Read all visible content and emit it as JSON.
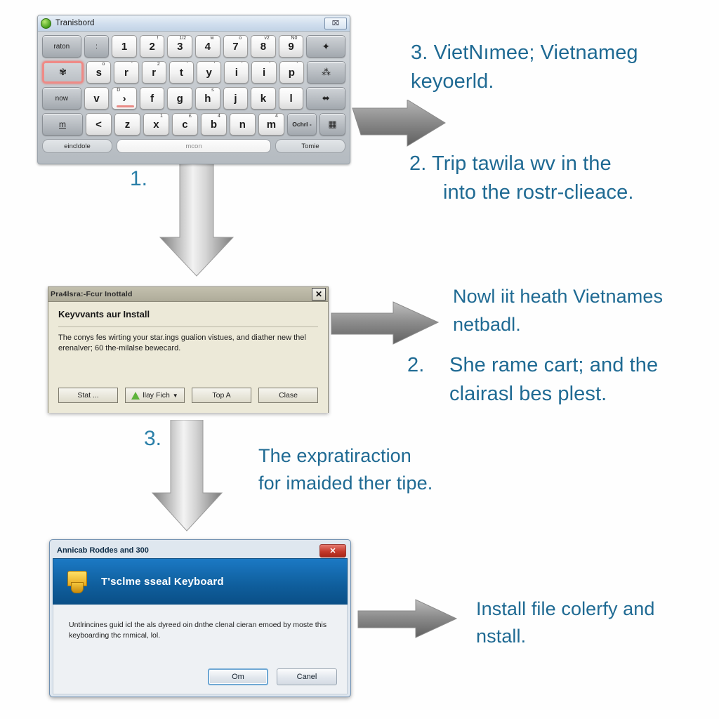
{
  "meta": {
    "accent_text_color": "#1f6a93",
    "arrow_color": "#9a9a9a",
    "canvas_bg": "#ffffff"
  },
  "osk": {
    "window_title": "Tranisbord",
    "minimize_label": "⌧",
    "rows": [
      {
        "id": "row-1",
        "keys": [
          {
            "label": "raton",
            "sup": "",
            "type": "dark",
            "width": "wide15"
          },
          {
            "label": ":",
            "sup": "",
            "type": "dark",
            "width": ""
          },
          {
            "label": "1",
            "sup": "",
            "type": "light",
            "width": ""
          },
          {
            "label": "2",
            "sup": "!",
            "type": "light",
            "width": ""
          },
          {
            "label": "3",
            "sup": "1/2",
            "type": "light",
            "width": ""
          },
          {
            "label": "4",
            "sup": "w",
            "type": "light",
            "width": ""
          },
          {
            "label": "7",
            "sup": "o",
            "type": "light",
            "width": ""
          },
          {
            "label": "8",
            "sup": "v2",
            "type": "light",
            "width": ""
          },
          {
            "label": "9",
            "sup": "N0",
            "type": "light",
            "width": ""
          },
          {
            "label": "✦",
            "sup": "",
            "type": "dark",
            "width": "wide15"
          }
        ]
      },
      {
        "id": "row-2",
        "keys": [
          {
            "label": "✾",
            "sup": "",
            "type": "dark selected",
            "width": "wide15"
          },
          {
            "label": "s",
            "sup": "o",
            "type": "light",
            "width": ""
          },
          {
            "label": "r",
            "sup": "'",
            "type": "light",
            "width": ""
          },
          {
            "label": "r",
            "sup": "2",
            "type": "light",
            "width": ""
          },
          {
            "label": "t",
            "sup": "'",
            "type": "light",
            "width": ""
          },
          {
            "label": "y",
            "sup": "'",
            "type": "light",
            "width": ""
          },
          {
            "label": "i",
            "sup": "'",
            "type": "light",
            "width": ""
          },
          {
            "label": "i",
            "sup": "'",
            "type": "light",
            "width": ""
          },
          {
            "label": "p",
            "sup": "'",
            "type": "light",
            "width": ""
          },
          {
            "label": "⁂",
            "sup": "",
            "type": "dark",
            "width": "wide15"
          }
        ]
      },
      {
        "id": "row-3",
        "keys": [
          {
            "label": "now",
            "sup": "",
            "type": "dark",
            "width": "wide15"
          },
          {
            "label": "v",
            "sup": "",
            "type": "light",
            "width": ""
          },
          {
            "label": "›",
            "sup": "D",
            "type": "light redmark",
            "width": ""
          },
          {
            "label": "f",
            "sup": "",
            "type": "light",
            "width": ""
          },
          {
            "label": "g",
            "sup": "",
            "type": "light",
            "width": ""
          },
          {
            "label": "h",
            "sup": "s",
            "type": "light",
            "width": ""
          },
          {
            "label": "j",
            "sup": "",
            "type": "light",
            "width": ""
          },
          {
            "label": "k",
            "sup": "",
            "type": "light",
            "width": ""
          },
          {
            "label": "l",
            "sup": "",
            "type": "light",
            "width": ""
          },
          {
            "label": "⬌",
            "sup": "",
            "type": "dark",
            "width": "wide15"
          }
        ]
      },
      {
        "id": "row-4",
        "keys": [
          {
            "label": "m",
            "sup": "",
            "type": "dark",
            "width": "wide15"
          },
          {
            "label": "<",
            "sup": "",
            "type": "light",
            "width": ""
          },
          {
            "label": "z",
            "sup": "",
            "type": "light",
            "width": ""
          },
          {
            "label": "x",
            "sup": "1",
            "type": "light",
            "width": ""
          },
          {
            "label": "c",
            "sup": "£",
            "type": "light",
            "width": ""
          },
          {
            "label": "b",
            "sup": "4",
            "type": "light",
            "width": ""
          },
          {
            "label": "n",
            "sup": "",
            "type": "light",
            "width": ""
          },
          {
            "label": "m",
            "sup": "4",
            "type": "light",
            "width": ""
          },
          {
            "label": "Ochrl -",
            "sup": "",
            "type": "dark",
            "width": ""
          },
          {
            "label": "▦",
            "sup": "",
            "type": "dark",
            "width": ""
          }
        ]
      }
    ],
    "bottom_row": {
      "left_label": "eincldole",
      "space_label": "mcon",
      "right_label": "Tomie"
    }
  },
  "dialog_mid": {
    "title": "Pra4lsra:-Fcur Inottald",
    "close_label": "✕",
    "heading": "Keyvvants aur Install",
    "paragraph": "The conys fes wirting your star.ings gualion vistues, and diather new thel erenalver; 60 the-milalse bewecard.",
    "buttons": [
      {
        "label": "Stat ...",
        "icon": ""
      },
      {
        "label": "llay Fich",
        "icon": "shield-icon",
        "caret": "▼"
      },
      {
        "label": "Top A",
        "icon": ""
      },
      {
        "label": "Clase",
        "icon": ""
      }
    ]
  },
  "dialog_bottom": {
    "title": "Annicab Roddes and 300",
    "close_label": "✕",
    "banner_title": "T'sclme sseal Keyboard",
    "banner_icon": "shield-icon",
    "paragraph": "Untlrincines guid icl the als dyreed oin dnthe clenal cieran emoed by moste this keyboarding thc rnmical, lol.",
    "buttons": [
      {
        "label": "Om",
        "primary": true
      },
      {
        "label": "Canel",
        "primary": false
      }
    ]
  },
  "annotations": [
    {
      "id": "note-top-right",
      "number": "3.",
      "lines": [
        "VietNımee; Vietnameg",
        "keyoerld."
      ]
    },
    {
      "id": "note-second-right",
      "number": "2.",
      "lines": [
        "Trip tawila wv in the",
        "into the rostr-clieace."
      ]
    },
    {
      "id": "note-mid-right-a",
      "number": "",
      "lines": [
        "Nowl iit heath Vietnames",
        "netbadl."
      ]
    },
    {
      "id": "note-mid-right-b",
      "number": "2.",
      "lines": [
        "She rame cart; and the",
        "clairasl bes plest."
      ]
    },
    {
      "id": "note-center",
      "number": "",
      "lines": [
        "The expratiraction",
        "for imaided ther tipe."
      ]
    },
    {
      "id": "note-bottom-right",
      "number": "",
      "lines": [
        "Install file colerfy and",
        "nstall."
      ]
    }
  ],
  "step_numbers": [
    {
      "id": "step-1",
      "label": "1."
    },
    {
      "id": "step-3-mid",
      "label": "3."
    }
  ]
}
